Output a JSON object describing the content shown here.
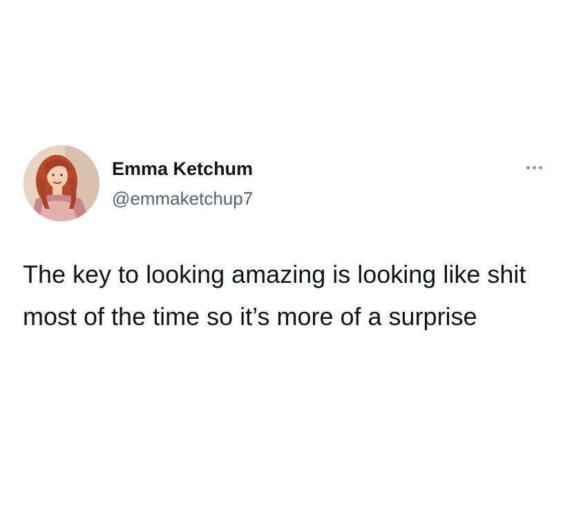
{
  "author": {
    "display_name": "Emma Ketchum",
    "handle": "@emmaketchup7",
    "avatar_icon": "profile-photo-avatar"
  },
  "menu": {
    "icon": "more-options-icon"
  },
  "tweet": {
    "text": "The key to looking amazing is looking like shit most of the time so it’s more of a surprise"
  },
  "colors": {
    "name": "#0f1419",
    "handle": "#536471",
    "background": "#ffffff",
    "dots": "#8b98a5"
  }
}
